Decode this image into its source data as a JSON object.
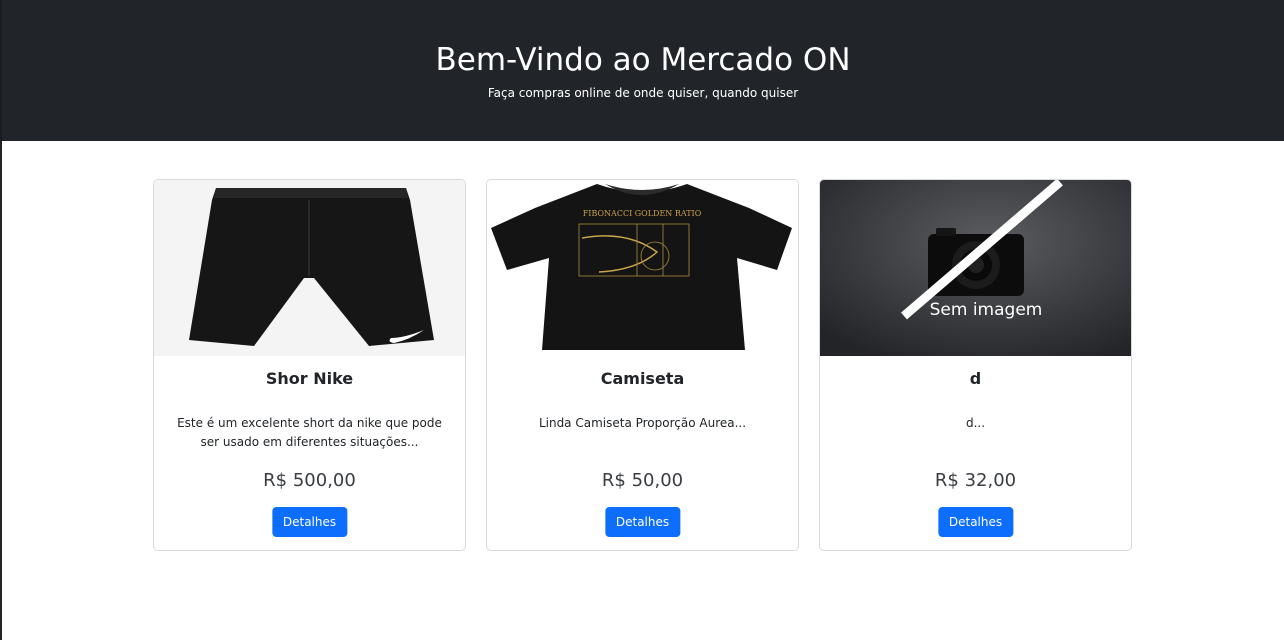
{
  "header": {
    "title": "Bem-Vindo ao Mercado ON",
    "subtitle": "Faça compras online de onde quiser, quando quiser"
  },
  "products": [
    {
      "name": "Shor Nike",
      "description": "Este é um excelente short da nike que pode ser usado em diferentes situações...",
      "price": "R$ 500,00",
      "button_label": "Detalhes"
    },
    {
      "name": "Camiseta",
      "description": "Linda Camiseta Proporção Aurea...",
      "price": "R$ 50,00",
      "button_label": "Detalhes",
      "shirt_print": "FIBONACCI GOLDEN RATIO"
    },
    {
      "name": "d",
      "description": "d...",
      "price": "R$ 32,00",
      "button_label": "Detalhes",
      "placeholder_label": "Sem imagem"
    }
  ],
  "colors": {
    "header_bg": "#212529",
    "button_bg": "#0d6efd",
    "card_border": "#d7d9dc"
  }
}
